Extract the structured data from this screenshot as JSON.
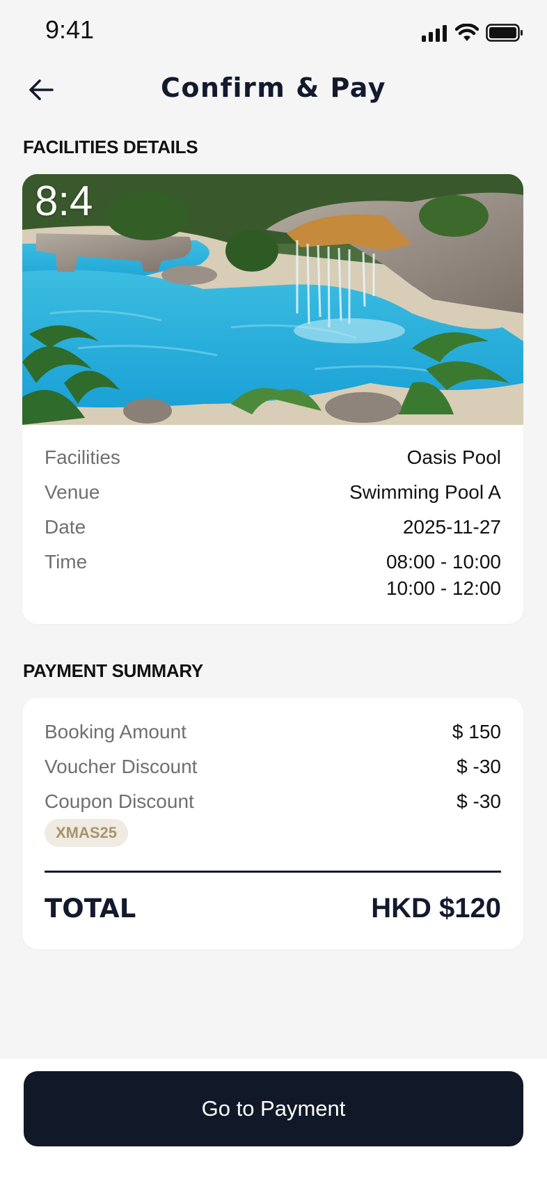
{
  "status_bar": {
    "time": "9:41",
    "icons": [
      "signal-icon",
      "wifi-icon",
      "battery-icon"
    ]
  },
  "header": {
    "back_icon": "arrow-left-icon",
    "title": "Confirm & Pay"
  },
  "facilities_section": {
    "title": "FACILITIES DETAILS",
    "image_label": "8:4",
    "rows": [
      {
        "label": "Facilities",
        "value": "Oasis Pool"
      },
      {
        "label": "Venue",
        "value": "Swimming Pool A"
      },
      {
        "label": "Date",
        "value": "2025-11-27"
      },
      {
        "label": "Time",
        "values": [
          "08:00 - 10:00",
          "10:00 - 12:00"
        ]
      }
    ]
  },
  "payment_section": {
    "title": "PAYMENT SUMMARY",
    "rows": [
      {
        "label": "Booking Amount",
        "value": "$ 150"
      },
      {
        "label": "Voucher Discount",
        "value": "$ -30"
      },
      {
        "label": "Coupon Discount",
        "value": "$ -30"
      }
    ],
    "coupon_code": "XMAS25",
    "total_label": "TOTAL",
    "total_value": "HKD $120"
  },
  "footer": {
    "button_label": "Go to Payment"
  },
  "colors": {
    "primary_dark": "#111827",
    "badge_bg": "#efebe3",
    "badge_text": "#a8946a",
    "background": "#f5f5f5"
  }
}
